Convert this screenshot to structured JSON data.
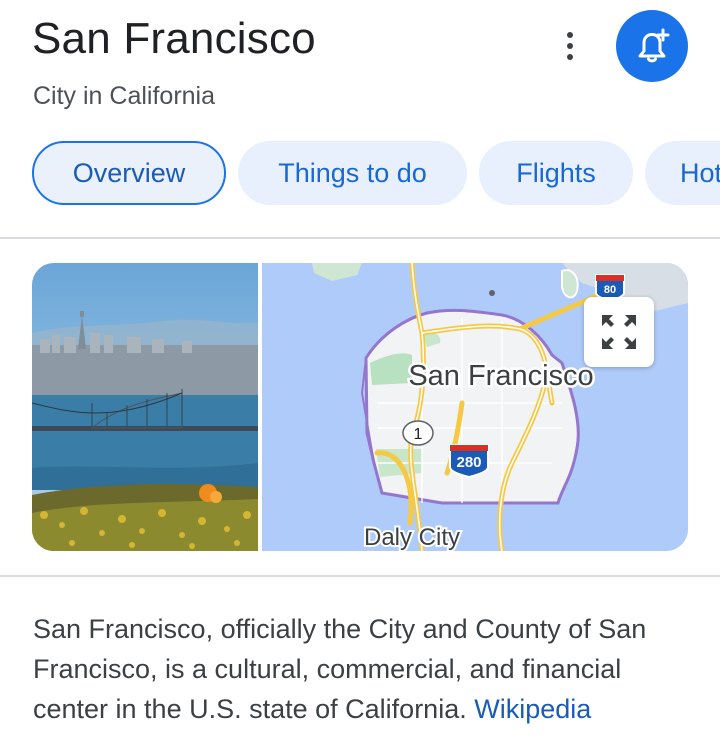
{
  "header": {
    "title": "San Francisco",
    "subtitle": "City in California"
  },
  "tabs": [
    {
      "label": "Overview",
      "active": true
    },
    {
      "label": "Things to do",
      "active": false
    },
    {
      "label": "Flights",
      "active": false
    },
    {
      "label": "Hotels",
      "active": false
    }
  ],
  "map": {
    "city_label": "San Francisco",
    "neighbor_label": "Daly City",
    "route_shield_1": "1",
    "interstate_280": "280",
    "interstate_80": "80"
  },
  "description": {
    "text": "San Francisco, officially the City and County of San Francisco, is a cultural, commercial, and financial center in the U.S. state of California.",
    "source_link": "Wikipedia"
  },
  "icons": {
    "more": "more-vert-icon",
    "bell": "add-notification-icon",
    "expand": "expand-map-icon"
  },
  "colors": {
    "accent": "#1a73e8",
    "tab_bg": "#e8f0fe",
    "divider": "#dadce0"
  }
}
